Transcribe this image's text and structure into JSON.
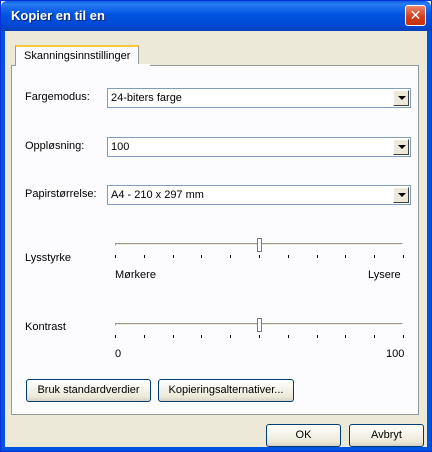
{
  "window": {
    "title": "Kopier en til en"
  },
  "tabs": [
    {
      "label": "Skanningsinnstillinger"
    }
  ],
  "settings": {
    "color_mode": {
      "label": "Fargemodus:",
      "value": "24-biters farge"
    },
    "resolution": {
      "label": "Oppløsning:",
      "value": "100"
    },
    "paper_size": {
      "label": "Papirstørrelse:",
      "value": "A4 - 210 x 297 mm"
    }
  },
  "brightness": {
    "label": "Lysstyrke",
    "min_label": "Mørkere",
    "max_label": "Lysere",
    "value": 0.5
  },
  "contrast": {
    "label": "Kontrast",
    "min_label": "0",
    "max_label": "100",
    "value": 0.5
  },
  "buttons": {
    "defaults": "Bruk standardverdier",
    "copy_options": "Kopieringsalternativer...",
    "ok": "OK",
    "cancel": "Avbryt"
  },
  "icons": {
    "close": "close-icon"
  }
}
